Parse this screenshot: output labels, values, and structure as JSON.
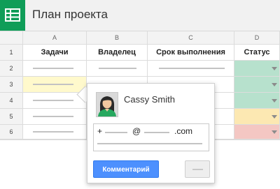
{
  "app": {
    "title": "План проекта"
  },
  "colors": {
    "accent_green": "#0f9d58",
    "status_green": "#b7e1cd",
    "status_yellow": "#fce8b2",
    "status_red": "#f4c7c3",
    "selected_yellow": "#fff9cc",
    "button_blue": "#4d90fe"
  },
  "sheet": {
    "columns": [
      "A",
      "B",
      "C",
      "D"
    ],
    "rows": [
      "1",
      "2",
      "3",
      "4",
      "5",
      "6"
    ],
    "headers": {
      "a": "Задачи",
      "b": "Владелец",
      "c": "Срок выполнения",
      "d": "Статус"
    }
  },
  "comment_popup": {
    "user_name": "Cassy Smith",
    "mention_plus": "+",
    "mention_at": "@",
    "mention_domain": ".com",
    "submit_label": "Комментарий"
  },
  "icons": {
    "logo": "sheets-logo-icon",
    "avatar": "user-avatar",
    "dropdown": "chevron-down-icon"
  }
}
